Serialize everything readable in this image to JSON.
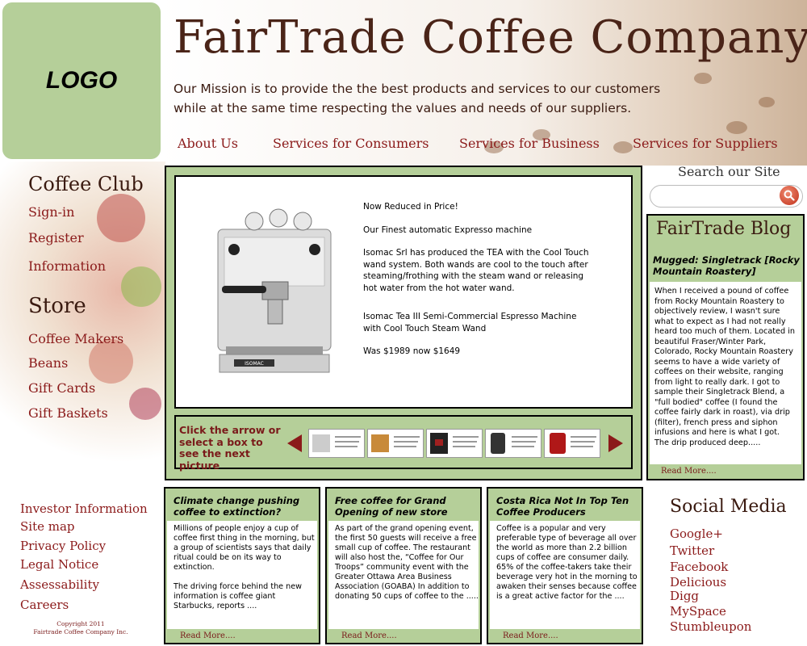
{
  "logo": {
    "text": "LOGO"
  },
  "header": {
    "title": "FairTrade Coffee Company",
    "mission_line1": "Our Mission is to provide the the best products and services to our customers",
    "mission_line2": "while at the same time respecting the values and needs of our suppliers."
  },
  "nav": {
    "items": [
      "About Us",
      "Services for Consumers",
      "Services for Business",
      "Services for Suppliers"
    ]
  },
  "search": {
    "label": "Search our Site",
    "placeholder": "",
    "button_icon": "search-icon"
  },
  "sidebar": {
    "coffee_club_heading": "Coffee Club",
    "coffee_club_links": [
      "Sign-in",
      "Register",
      "Information"
    ],
    "store_heading": "Store",
    "store_links": [
      "Coffee Makers",
      "Beans",
      "Gift Cards",
      "Gift Baskets"
    ]
  },
  "feature": {
    "line1": "Now Reduced in Price!",
    "line2": "Our Finest automatic Expresso machine",
    "para": "Isomac Srl has produced  the TEA with the Cool Touch wand system. Both wands are cool to the touch after steaming/frothing with the steam wand or releasing hot water from the hot water wand.",
    "product_name": "Isomac Tea III Semi-Commercial Espresso Machine with Cool Touch Steam Wand",
    "price": "Was $1989 now $1649",
    "machine_badge": "ISOMAC"
  },
  "carousel": {
    "instruction": "Click the arrow or select a box to see the next picture",
    "prev_icon": "arrow-left-icon",
    "next_icon": "arrow-right-icon"
  },
  "blog": {
    "heading": "FairTrade Blog",
    "post_title": "Mugged: Singletrack [Rocky Mountain Roastery]",
    "post_body_1": "When I received a pound of coffee from Rocky Mountain Roastery to objectively review, I wasn't sure what to expect as I had not really heard too much of them. Located in beautiful Fraser/Winter Park, Colorado, Rocky Mountain Roastery seems to have a wide variety of coffees on their website, ranging from light to really dark. I got to sample their Singletrack Blend, a \"full bodied\" coffee (I found the coffee fairly dark in roast), via drip (filter), french press and siphon infusions and here is what I got.",
    "post_body_2": "The drip produced deep.....",
    "read_more": "Read More...."
  },
  "news": [
    {
      "title": "Climate change pushing coffee to extinction?",
      "body_1": "Millions of people enjoy a cup of coffee first thing in the morning, but a group of scientists says that daily ritual could be on its way to extinction.",
      "body_2": "The driving force behind the new information is coffee giant Starbucks, reports ....",
      "read_more": "Read More...."
    },
    {
      "title": "Free coffee for Grand Opening of new store",
      "body_1": "As part of the grand opening event, the first 50 guests will receive a free small cup of coffee. The restaurant will also host the, “Coffee for Our Troops” community event with the Greater Ottawa Area Business Association (GOABA) In addition to donating 50 cups of coffee to the .....",
      "body_2": "",
      "read_more": "Read More...."
    },
    {
      "title": "Costa Rica Not In Top Ten Coffee Producers",
      "body_1": "Coffee is a popular and very preferable type of beverage all over the world as more than 2.2 billion cups of coffee are consumer daily. 65% of the coffee-takers take their beverage very hot in the morning to awaken their senses because coffee is a great active factor for the ....",
      "body_2": "",
      "read_more": "Read More...."
    }
  ],
  "footer": {
    "links": [
      "Investor Information",
      "Site map",
      "Privacy Policy",
      "Legal Notice",
      "Assessability",
      "Careers"
    ],
    "copyright_line1": "Copyright 2011",
    "copyright_line2": "Fairtrade Coffee Company Inc."
  },
  "social": {
    "heading": "Social Media",
    "links": [
      "Google+",
      "Twitter",
      "Facebook",
      "Delicious",
      "Digg",
      "MySpace",
      "Stumbleupon"
    ]
  },
  "colors": {
    "accent_green": "#b5cf99",
    "link_red": "#8b1a1a",
    "heading_brown": "#3a1a10"
  }
}
